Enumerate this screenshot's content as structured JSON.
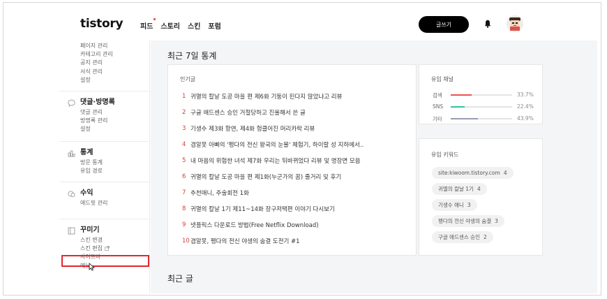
{
  "header": {
    "logo": "tistory",
    "nav": [
      "피드",
      "스토리",
      "스킨",
      "포럼"
    ],
    "write_label": "글쓰기"
  },
  "sidebar": {
    "top_items": [
      "페이지 관리",
      "카테고리 관리",
      "공지 관리",
      "서식 관리",
      "설정"
    ],
    "sections": [
      {
        "title": "댓글·방명록",
        "icon": "speech-bubble-icon",
        "items": [
          "댓글 관리",
          "방명록 관리",
          "설정"
        ]
      },
      {
        "title": "통계",
        "icon": "stats-icon",
        "items": [
          "방문 통계",
          "유입 경로"
        ]
      },
      {
        "title": "수익",
        "icon": "revenue-icon",
        "items": [
          "애드핏 관리"
        ]
      },
      {
        "title": "꾸미기",
        "icon": "layout-icon",
        "items": [
          "스킨 변경",
          "스킨 편집",
          "사이드바",
          "메뉴"
        ]
      }
    ]
  },
  "main": {
    "stats_title": "최근 7일 통계",
    "popular": {
      "title": "인기글",
      "posts": [
        {
          "rank": "1",
          "title": "귀멸의 칼날 도공 마을 편 제6화 기둥이 된다지 않았냐고 리뷰"
        },
        {
          "rank": "2",
          "title": "구글 애드센스 승인 거절당하고 진울해서 쓴 글"
        },
        {
          "rank": "3",
          "title": "기생수 제3화 항연, 제4화 헝클어진 머리카락 리뷰"
        },
        {
          "rank": "4",
          "title": "겸알못 아빠의 '펭다의 전신 왕국의 눈물' 체험기, 하이랄 성 지하에서.."
        },
        {
          "rank": "5",
          "title": "내 마음의 위험한 녀석 제7화 우리는 뒤바뀌었다 리뷰 및 명장면 모음"
        },
        {
          "rank": "6",
          "title": "귀멸의 칼날 도공 마을 편 제1화(누군가의 꿈) 줄거리 및 후기"
        },
        {
          "rank": "7",
          "title": "추천애니, 주술회전 1화"
        },
        {
          "rank": "8",
          "title": "귀멸의 칼날 1기 제11~14화 장구저택편 이야기 다시보기"
        },
        {
          "rank": "9",
          "title": "넷플릭스 다운로드 방법(Free Netflix Download)"
        },
        {
          "rank": "10",
          "title": "겸알못, 펭다의 전신 야생의 숨결 도전기 #1"
        }
      ]
    },
    "channels": {
      "title": "유입 채널",
      "rows": [
        {
          "name": "검색",
          "pct": "33.7%",
          "value": 0.337,
          "color": "#f05050"
        },
        {
          "name": "SNS",
          "pct": "22.4%",
          "value": 0.224,
          "color": "#2ec4a0"
        },
        {
          "name": "기타",
          "pct": "43.9%",
          "value": 0.439,
          "color": "#9a9ab8"
        }
      ]
    },
    "keywords": {
      "title": "유입 키워드",
      "items": [
        {
          "word": "site:kiwoom.tistory.com",
          "count": "4"
        },
        {
          "word": "귀멸의 칼날 1기",
          "count": "4"
        },
        {
          "word": "기생수 애니",
          "count": "3"
        },
        {
          "word": "펭다의 전신 야생의 숨결",
          "count": "3"
        },
        {
          "word": "구글 애드센스 승인",
          "count": "2"
        }
      ]
    },
    "recent_title": "최근 글"
  }
}
